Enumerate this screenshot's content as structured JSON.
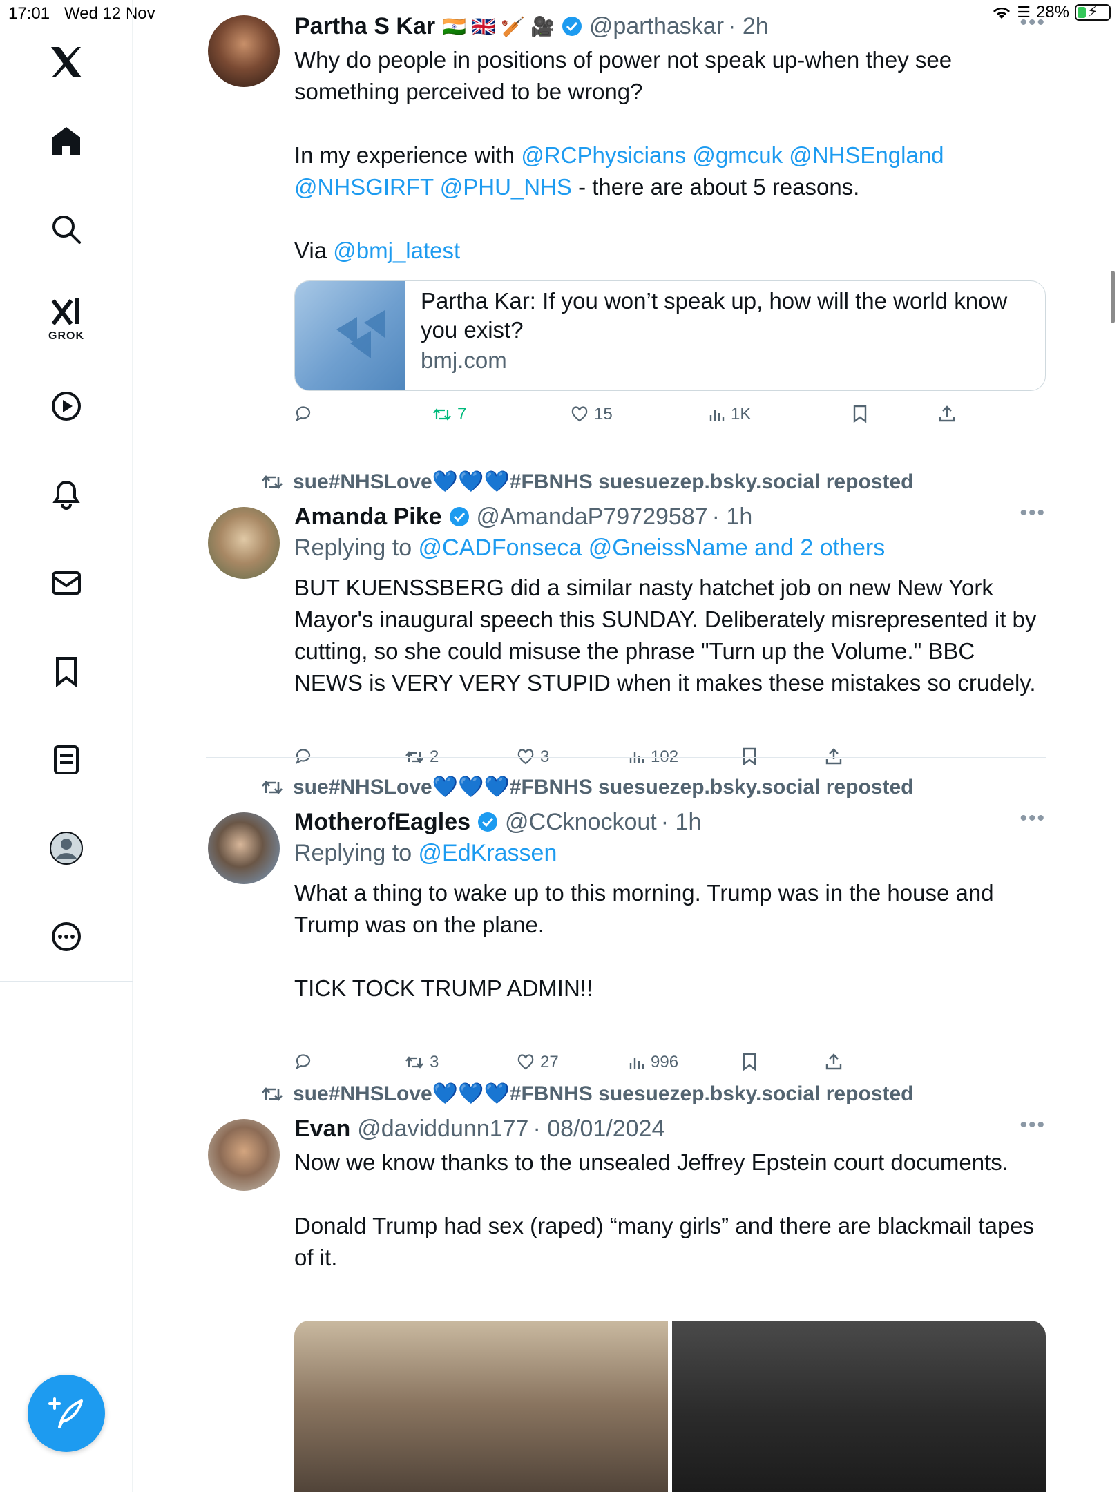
{
  "status_bar": {
    "time": "17:01",
    "date": "Wed 12 Nov",
    "battery": "28%",
    "battery_level": 0.28
  },
  "sidebar": {
    "items": [
      {
        "icon": "x-logo-icon"
      },
      {
        "icon": "home-icon"
      },
      {
        "icon": "search-icon"
      },
      {
        "icon": "grok-icon",
        "label": "GROK"
      },
      {
        "icon": "play-icon"
      },
      {
        "icon": "bell-icon"
      },
      {
        "icon": "mail-icon"
      },
      {
        "icon": "bookmark-icon"
      },
      {
        "icon": "list-icon"
      },
      {
        "icon": "profile-icon"
      },
      {
        "icon": "more-circle-icon"
      }
    ],
    "compose_icon": "compose-icon"
  },
  "tweets": [
    {
      "name": "Partha S Kar",
      "flags": "🇮🇳 🇬🇧 🏏 🎥",
      "handle": "@parthaskar",
      "time": "· 2h",
      "text_1": "Why do people in positions of power not speak up-when they see something perceived to be wrong?",
      "text_2_prefix": "In my experience with ",
      "mentions_2": "@RCPhysicians @gmcuk @NHSEngland @NHSGIRFT @PHU_NHS",
      "text_2_suffix": " - there are about 5 reasons.",
      "text_3_prefix": "Via ",
      "mention_3": "@bmj_latest",
      "card": {
        "title": "Partha Kar: If you won’t speak up, how will the world know you exist?",
        "domain": "bmj.com"
      },
      "actions": {
        "reply": "",
        "retweet": "7",
        "like": "15",
        "views": "1K"
      }
    },
    {
      "repost_by": "sue#NHSLove💙💙💙#FBNHS suesuezep.bsky.social reposted",
      "name": "Amanda Pike",
      "handle": "@AmandaP79729587",
      "time": "· 1h",
      "replying_prefix": "Replying to ",
      "replying_to": "@CADFonseca @GneissName and 2 others",
      "text": "BUT KUENSSBERG did a similar nasty hatchet job on new New York Mayor's inaugural speech this SUNDAY. Deliberately misrepresented it by cutting, so she could misuse the phrase \"Turn up the Volume.\" BBC NEWS is VERY VERY STUPID when it makes these mistakes so crudely.",
      "actions": {
        "reply": "",
        "retweet": "2",
        "like": "3",
        "views": "102"
      }
    },
    {
      "repost_by": "sue#NHSLove💙💙💙#FBNHS suesuezep.bsky.social reposted",
      "name": "MotherofEagles",
      "handle": "@CCknockout",
      "time": "· 1h",
      "replying_prefix": "Replying to ",
      "replying_to": "@EdKrassen",
      "text": "What a thing to wake up to this morning. Trump was in the house and Trump was on the plane.\n\nTICK TOCK TRUMP ADMIN!!",
      "actions": {
        "reply": "",
        "retweet": "3",
        "like": "27",
        "views": "996"
      }
    },
    {
      "repost_by": "sue#NHSLove💙💙💙#FBNHS suesuezep.bsky.social reposted",
      "name": "Evan",
      "handle": "@daviddunn177",
      "time": "· 08/01/2024",
      "text": "Now we know thanks to the unsealed Jeffrey Epstein court documents.\n\nDonald Trump had sex (raped) “many girls” and there are blackmail tapes of it."
    }
  ],
  "colors": {
    "accent": "#1d9bf0",
    "retweet_green": "#00ba7c",
    "muted": "#536471"
  }
}
